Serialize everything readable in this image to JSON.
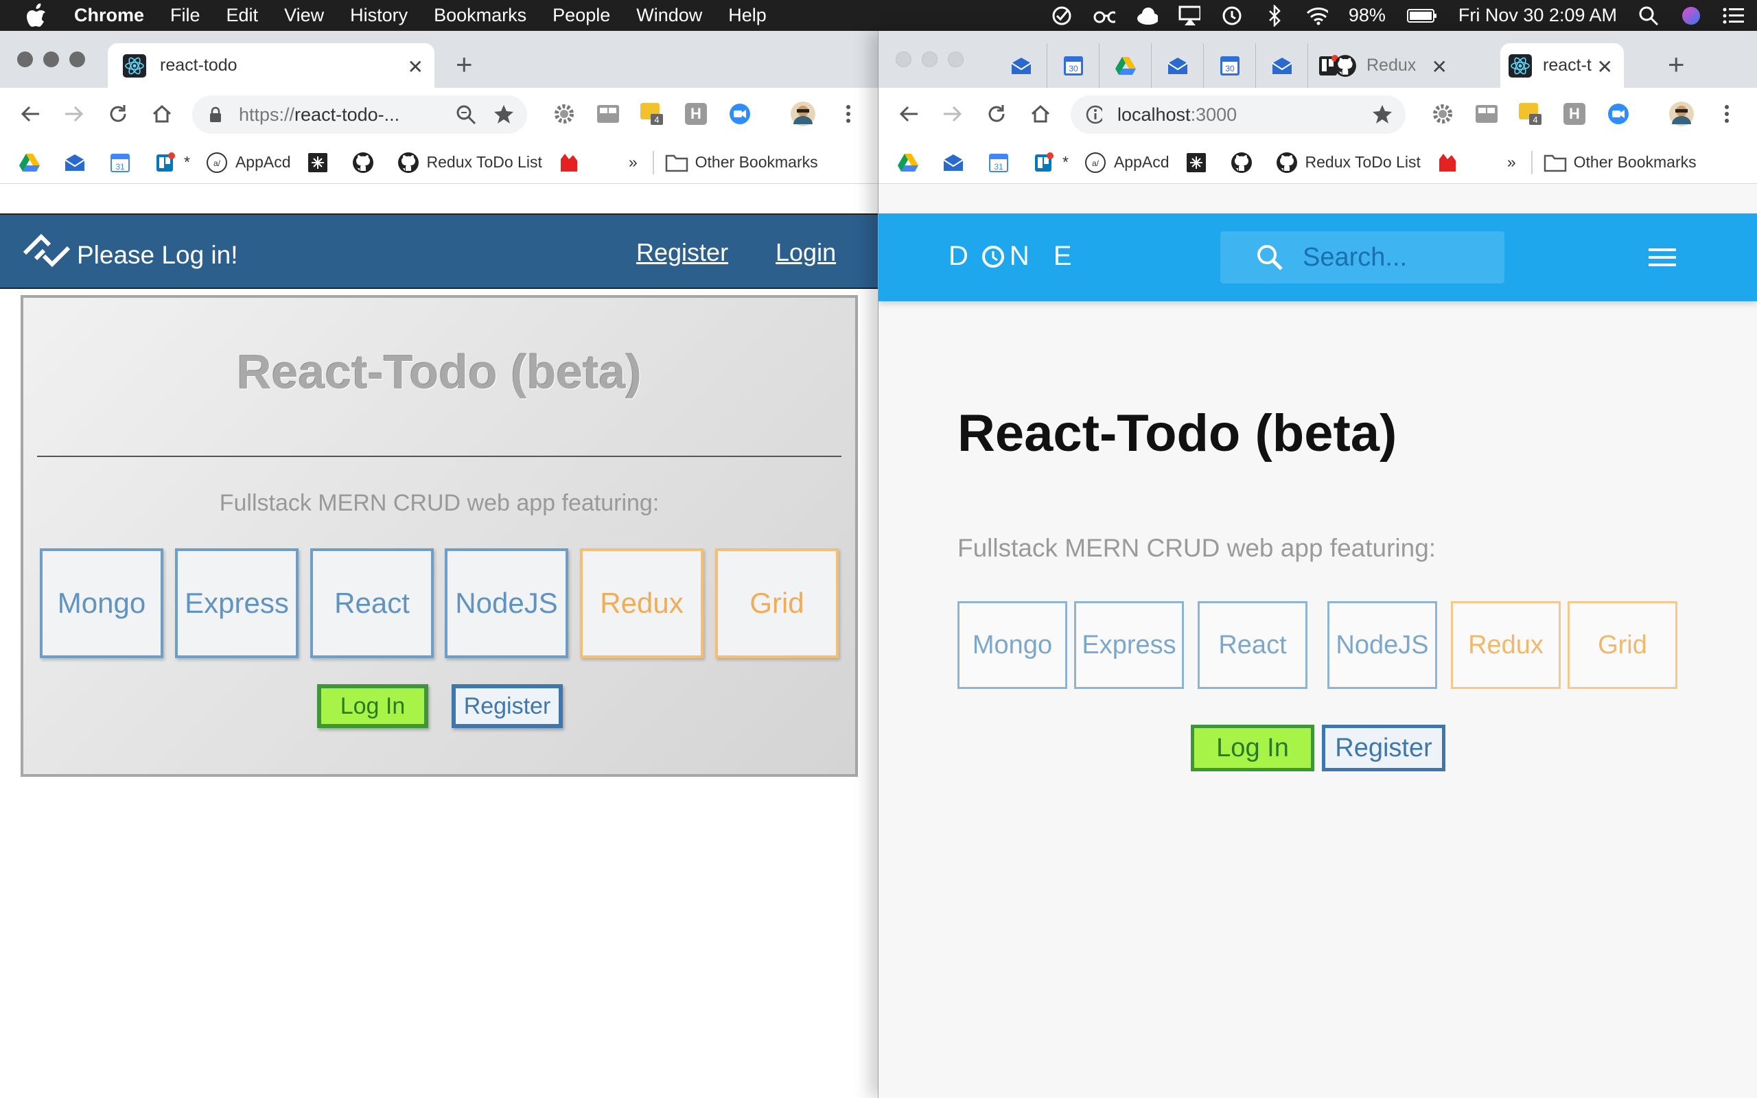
{
  "menubar": {
    "app_name": "Chrome",
    "items": [
      "File",
      "Edit",
      "View",
      "History",
      "Bookmarks",
      "People",
      "Window",
      "Help"
    ],
    "battery": "98%",
    "clock": "Fri Nov 30  2:09 AM"
  },
  "left_window": {
    "tab_title": "react-todo",
    "url_scheme": "https://",
    "url_rest": "react-todo-...",
    "extension_badge": "4",
    "bookmarks": {
      "asterisk": "*",
      "appacd": "AppAcd",
      "redux": "Redux ToDo List",
      "more": "»",
      "other": "Other Bookmarks"
    },
    "page": {
      "nav_title": "Please Log in!",
      "nav_register": "Register",
      "nav_login": "Login",
      "heading": "React-Todo (beta)",
      "subtitle": "Fullstack MERN CRUD web app featuring:",
      "tiles": [
        "Mongo",
        "Express",
        "React",
        "NodeJS",
        "Redux",
        "Grid"
      ],
      "login_button": "Log In",
      "register_button": "Register"
    }
  },
  "right_window": {
    "redux_tab": "Redux",
    "active_tab": "react-t",
    "url_host": "localhost",
    "url_port": ":3000",
    "extension_badge": "4",
    "bookmarks": {
      "asterisk": "*",
      "appacd": "AppAcd",
      "redux": "Redux ToDo List",
      "more": "»",
      "other": "Other Bookmarks"
    },
    "page": {
      "logo_left": "D",
      "logo_right": "N E",
      "search_placeholder": "Search...",
      "heading": "React-Todo (beta)",
      "subtitle": "Fullstack MERN CRUD web app featuring:",
      "tiles": [
        "Mongo",
        "Express",
        "React",
        "NodeJS",
        "Redux",
        "Grid"
      ],
      "login_button": "Log In",
      "register_button": "Register"
    }
  },
  "colors": {
    "left_nav": "#2d5f8d",
    "right_nav": "#1ea7ec",
    "login_green": "#a8f348",
    "register_blue": "#3d77ad",
    "tile_blue": "#6d9ec9",
    "tile_orange": "#f4be75"
  }
}
